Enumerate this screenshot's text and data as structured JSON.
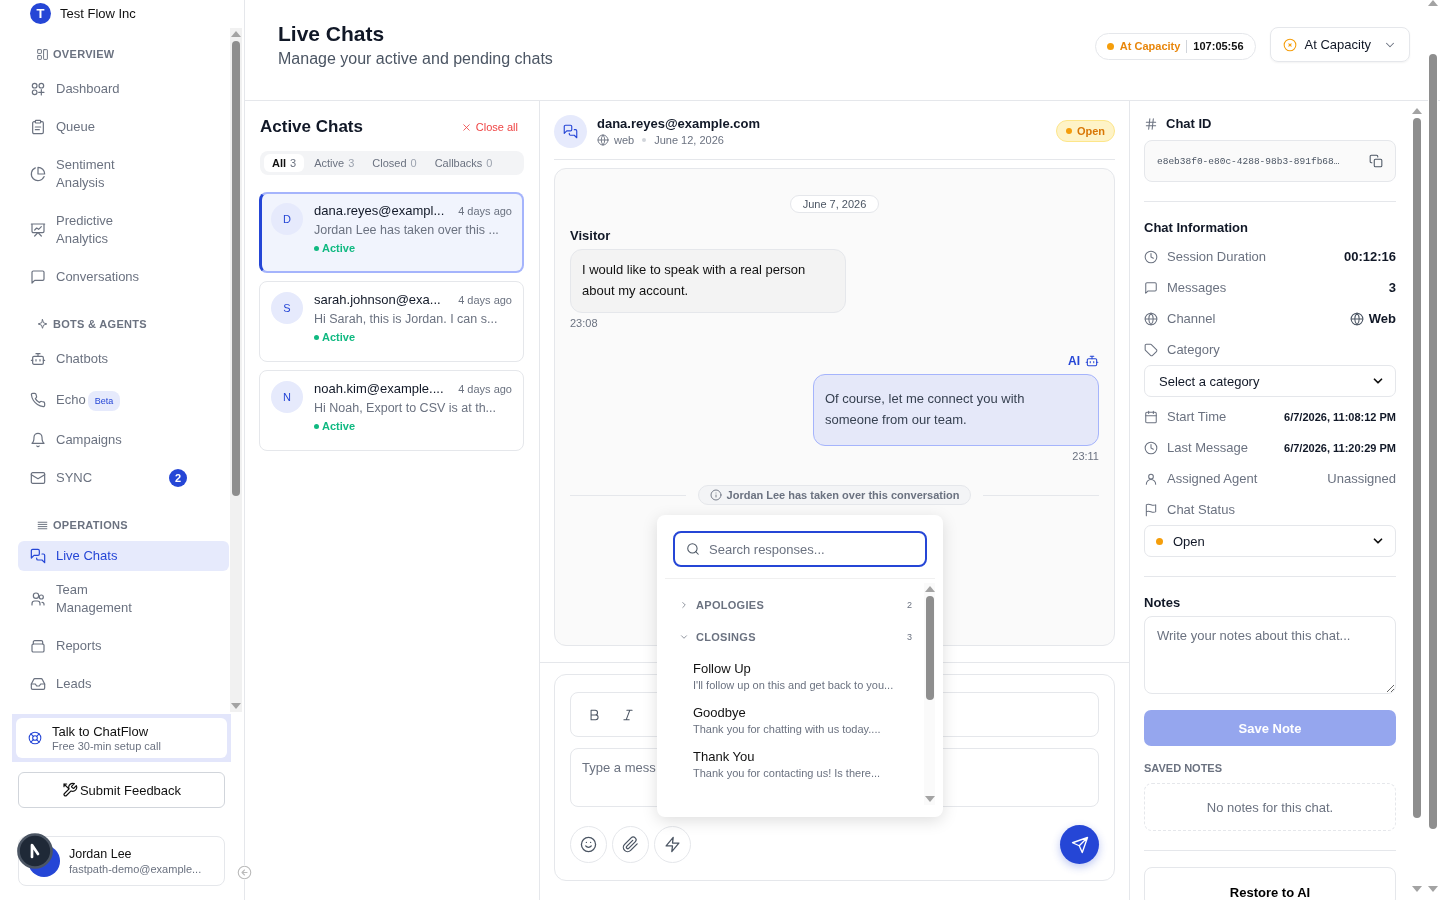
{
  "sidebar": {
    "org": {
      "initial": "T",
      "name": "Test Flow Inc"
    },
    "sections": [
      {
        "title": "OVERVIEW",
        "items": [
          {
            "label": "Dashboard",
            "selected": false
          },
          {
            "label": "Queue",
            "selected": false
          },
          {
            "label": "Sentiment Analysis",
            "selected": false
          },
          {
            "label": "Predictive Analytics",
            "selected": false
          },
          {
            "label": "Conversations",
            "selected": false
          }
        ]
      },
      {
        "title": "BOTS & AGENTS",
        "items": [
          {
            "label": "Chatbots",
            "selected": false
          },
          {
            "label": "Echo",
            "badge": "Beta",
            "selected": false
          },
          {
            "label": "Campaigns",
            "selected": false
          },
          {
            "label": "SYNC",
            "count": "2",
            "selected": false
          }
        ]
      },
      {
        "title": "OPERATIONS",
        "items": [
          {
            "label": "Live Chats",
            "selected": true
          },
          {
            "label": "Team Management",
            "selected": false
          },
          {
            "label": "Reports",
            "selected": false
          },
          {
            "label": "Leads",
            "selected": false
          }
        ]
      }
    ],
    "promo": {
      "title": "Talk to ChatFlow",
      "subtitle": "Free 30-min setup call"
    },
    "feedback_button": "Submit Feedback",
    "user": {
      "name": "Jordan Lee",
      "email": "fastpath-demo@example..."
    }
  },
  "header": {
    "title": "Live Chats",
    "subtitle": "Manage your active and pending chats",
    "capacity": {
      "status": "At Capacity",
      "timer": "107:05:56"
    },
    "status_select": "At Capacity"
  },
  "chat_list": {
    "title": "Active Chats",
    "close_all": "Close all",
    "filters": [
      {
        "label": "All",
        "count": "3",
        "selected": true
      },
      {
        "label": "Active",
        "count": "3",
        "selected": false
      },
      {
        "label": "Closed",
        "count": "0",
        "selected": false
      },
      {
        "label": "Callbacks",
        "count": "0",
        "selected": false
      }
    ],
    "chats": [
      {
        "initial": "D",
        "name": "dana.reyes@exampl...",
        "time": "4 days ago",
        "preview": "Jordan Lee has taken over this ...",
        "status": "Active",
        "selected": true
      },
      {
        "initial": "S",
        "name": "sarah.johnson@exa...",
        "time": "4 days ago",
        "preview": "Hi Sarah, this is Jordan. I can s...",
        "status": "Active",
        "selected": false
      },
      {
        "initial": "N",
        "name": "noah.kim@example....",
        "time": "4 days ago",
        "preview": "Hi Noah, Export to CSV is at th...",
        "status": "Active",
        "selected": false
      }
    ]
  },
  "conversation": {
    "contact": "dana.reyes@example.com",
    "channel": "web",
    "date": "June 12, 2026",
    "status": "Open",
    "messages": [
      {
        "kind": "date",
        "text": "June 7, 2026"
      },
      {
        "kind": "visitor",
        "sender": "Visitor",
        "text": "I would like to speak with a real person about my account.",
        "time": "23:08"
      },
      {
        "kind": "ai",
        "sender": "AI",
        "text": "Of course, let me connect you with someone from our team.",
        "time": "23:11"
      },
      {
        "kind": "system",
        "text": "Jordan Lee has taken over this conversation"
      }
    ],
    "composer": {
      "placeholder": "Type a mess"
    },
    "quick_responses": {
      "placeholder": "Search responses...",
      "groups": [
        {
          "name": "APOLOGIES",
          "count": "2",
          "expanded": false
        },
        {
          "name": "CLOSINGS",
          "count": "3",
          "expanded": true,
          "items": [
            {
              "title": "Follow Up",
              "text": "I'll follow up on this and get back to you..."
            },
            {
              "title": "Goodbye",
              "text": "Thank you for chatting with us today...."
            },
            {
              "title": "Thank You",
              "text": "Thank you for contacting us! Is there..."
            }
          ]
        }
      ]
    }
  },
  "details": {
    "chat_id_label": "Chat ID",
    "chat_id": "e8eb38f0-e80c-4288-98b3-891fb68…",
    "info_title": "Chat Information",
    "fields": [
      {
        "kind": "value",
        "label": "Session Duration",
        "value": "00:12:16"
      },
      {
        "kind": "value",
        "label": "Messages",
        "value": "3"
      },
      {
        "kind": "channel",
        "label": "Channel",
        "value": "Web"
      },
      {
        "kind": "select",
        "label": "Category",
        "value": "Select a category"
      },
      {
        "kind": "datetime",
        "label": "Start Time",
        "value": "6/7/2026, 11:08:12 PM"
      },
      {
        "kind": "datetime",
        "label": "Last Message",
        "value": "6/7/2026, 11:20:29 PM"
      },
      {
        "kind": "muted",
        "label": "Assigned Agent",
        "value": "Unassigned"
      },
      {
        "kind": "status",
        "label": "Chat Status",
        "value": "Open"
      }
    ],
    "notes_title": "Notes",
    "notes_placeholder": "Write your notes about this chat...",
    "save_button": "Save Note",
    "saved_title": "SAVED NOTES",
    "saved_empty": "No notes for this chat.",
    "restore_button": "Restore to AI"
  }
}
